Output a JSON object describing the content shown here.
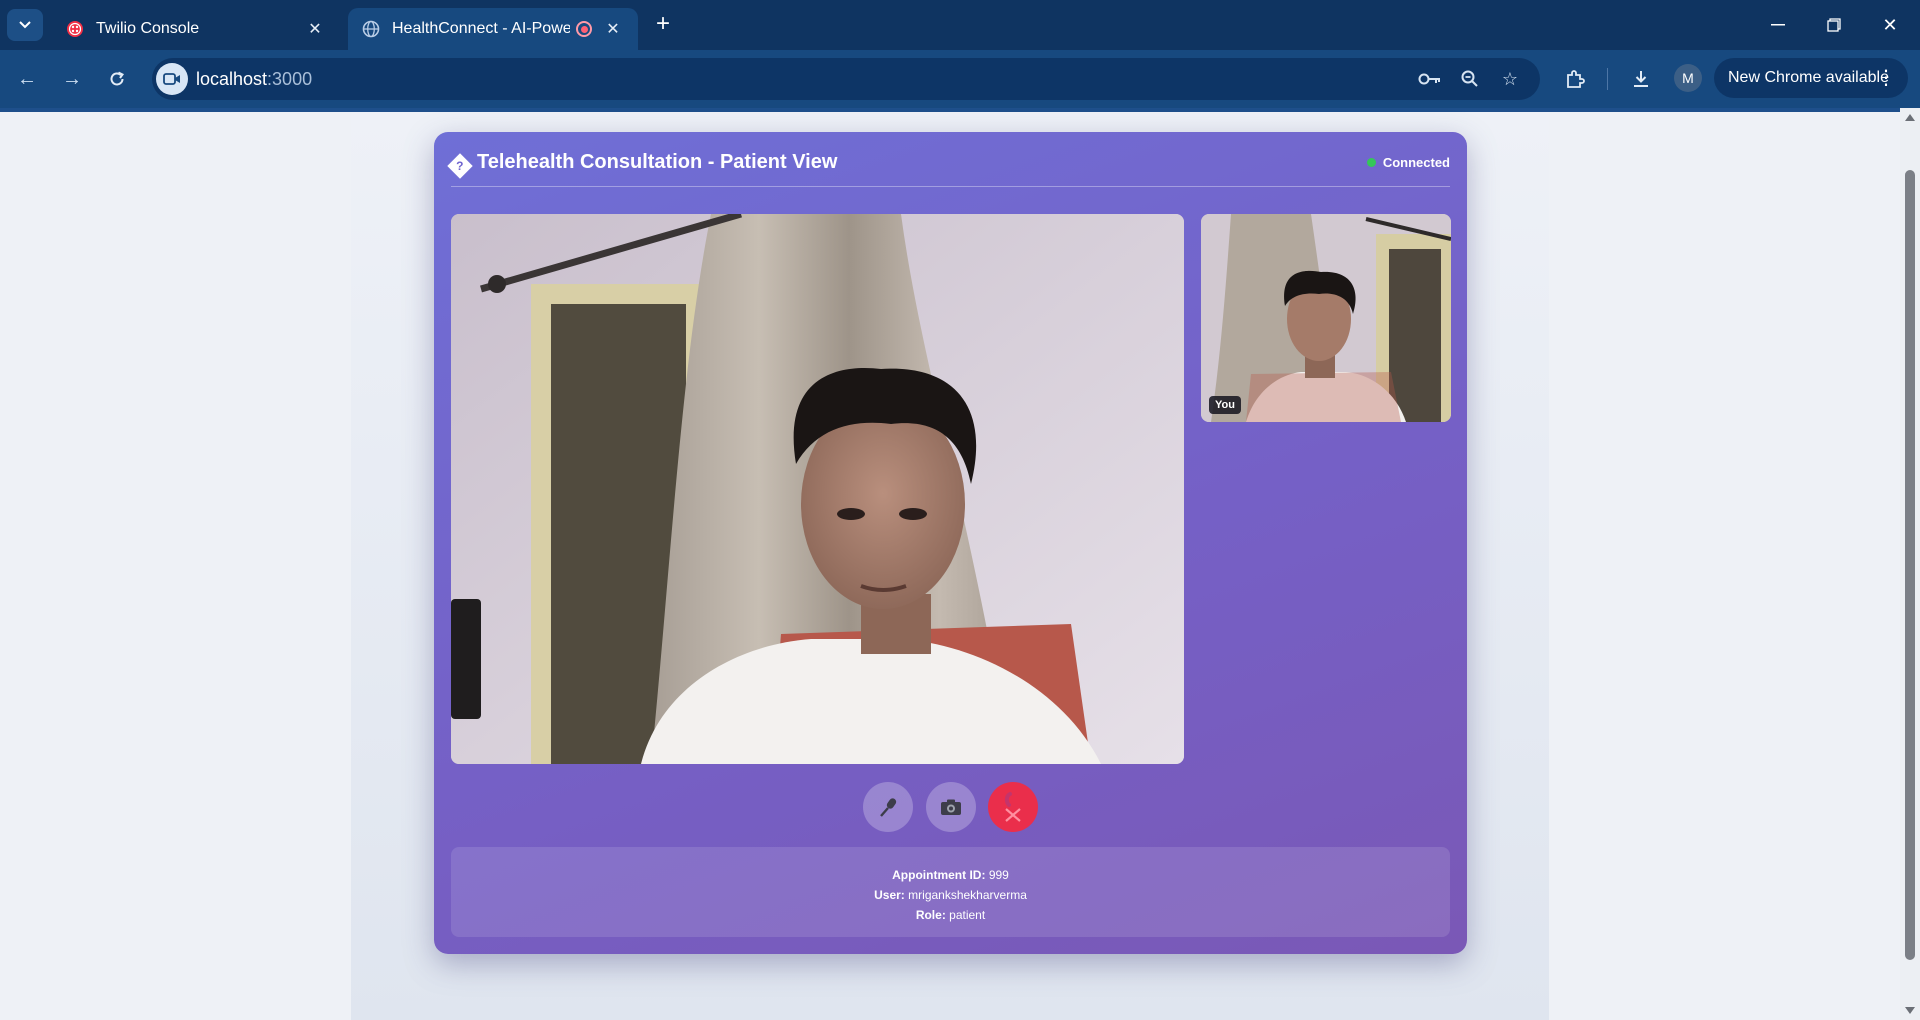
{
  "browser": {
    "tabs": [
      {
        "title": "Twilio Console",
        "favicon": "twilio-icon",
        "active": false
      },
      {
        "title": "HealthConnect - AI-Powered",
        "favicon": "globe-icon",
        "active": true,
        "recording": true
      }
    ],
    "url_host": "localhost",
    "url_port": ":3000",
    "profile_initial": "M",
    "update_label": "New Chrome available"
  },
  "consultation": {
    "title": "Telehealth Consultation - Patient View",
    "title_glyph": "?",
    "status": "Connected",
    "status_color": "#34c759",
    "local_label": "You",
    "controls": [
      {
        "name": "microphone",
        "icon": "microphone-icon"
      },
      {
        "name": "camera",
        "icon": "camera-icon"
      },
      {
        "name": "end-call",
        "icon": "phone-hangup-icon",
        "color": "#ea2e4b"
      }
    ],
    "info": {
      "appointment_label": "Appointment ID:",
      "appointment_value": "999",
      "user_label": "User:",
      "user_value": "mrigankshekharverma",
      "role_label": "Role:",
      "role_value": "patient"
    }
  },
  "colors": {
    "chrome_frame": "#0f3461",
    "chrome_toolbar": "#17497f",
    "card_accent": "#6f6fd6"
  }
}
